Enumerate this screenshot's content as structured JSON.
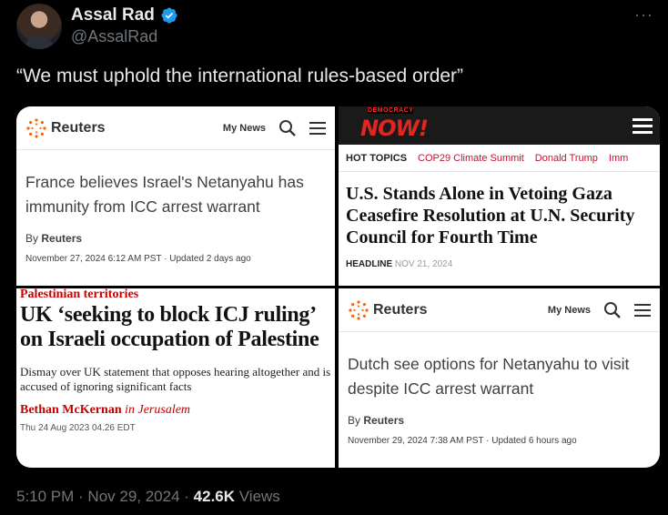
{
  "author": {
    "name": "Assal Rad",
    "handle": "@AssalRad"
  },
  "tweet": {
    "text": "“We must uphold the international rules-based order”"
  },
  "panels": {
    "reuters1": {
      "brand": "Reuters",
      "nav": "My News",
      "headline": "France believes Israel's Netanyahu has immunity from ICC arrest warrant",
      "by_prefix": "By",
      "by_name": "Reuters",
      "date": "November 27, 2024 6:12 AM PST · Updated 2 days ago"
    },
    "democracynow": {
      "logo_top": "DEMOCRACY",
      "logo_main": "NOW!",
      "nav": [
        "HOT TOPICS",
        "COP29 Climate Summit",
        "Donald Trump",
        "Imm"
      ],
      "headline": "U.S. Stands Alone in Vetoing Gaza Ceasefire Resolution at U.N. Security Council for Fourth Time",
      "label": "HEADLINE",
      "date": "NOV 21, 2024"
    },
    "guardian": {
      "kicker": "Palestinian territories",
      "headline": "UK ‘seeking to block ICJ ruling’ on Israeli occupation of Palestine",
      "standfirst": "Dismay over UK statement that opposes hearing altogether and is accused of ignoring significant facts",
      "byline_name": "Bethan McKernan",
      "byline_place": "in Jerusalem",
      "date": "Thu 24 Aug 2023 04.26 EDT"
    },
    "reuters2": {
      "brand": "Reuters",
      "nav": "My News",
      "headline": "Dutch see options for Netanyahu to visit despite ICC arrest warrant",
      "by_prefix": "By",
      "by_name": "Reuters",
      "date": "November 29, 2024 7:38 AM PST · Updated 6 hours ago"
    }
  },
  "footer": {
    "time": "5:10 PM · Nov 29, 2024 · ",
    "views_count": "42.6K",
    "views_label": " Views"
  },
  "colors": {
    "verified": "#1d9bf0",
    "reuters_orange": "#fa6400",
    "guardian_red": "#c70000",
    "dn_red": "#e0261f"
  },
  "icons": [
    "verified-badge-icon",
    "more-icon",
    "reuters-logo-icon",
    "search-icon",
    "menu-icon"
  ]
}
